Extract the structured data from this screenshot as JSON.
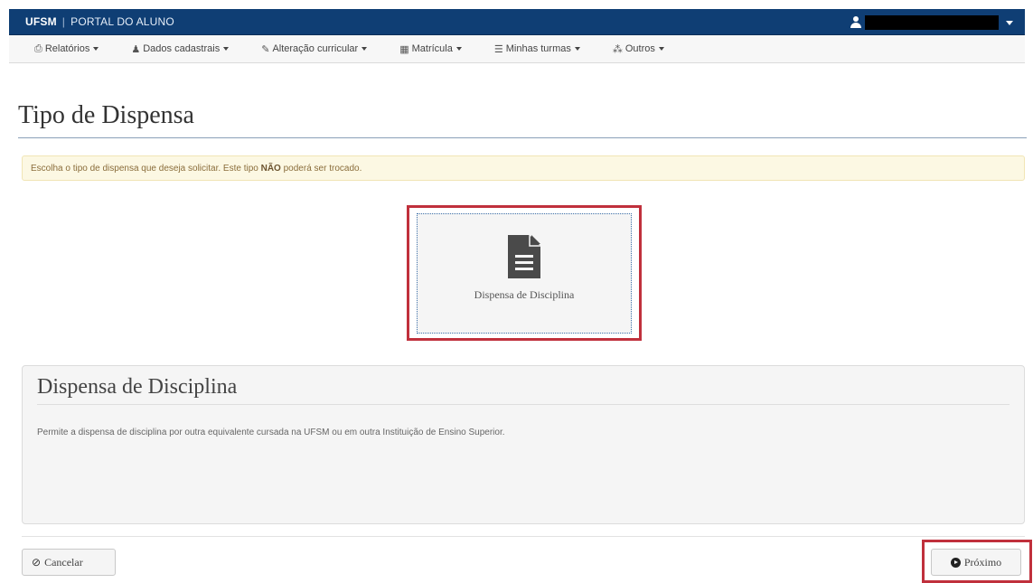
{
  "header": {
    "brand": "UFSM",
    "separator": "|",
    "portal": "PORTAL DO ALUNO"
  },
  "menu": [
    {
      "label": "Relatórios",
      "icon": "print-icon",
      "glyph": "⎙"
    },
    {
      "label": "Dados cadastrais",
      "icon": "user-icon",
      "glyph": "♟"
    },
    {
      "label": "Alteração curricular",
      "icon": "edit-icon",
      "glyph": "✎"
    },
    {
      "label": "Matrícula",
      "icon": "calendar-icon",
      "glyph": "▦"
    },
    {
      "label": "Minhas turmas",
      "icon": "list-icon",
      "glyph": "☰"
    },
    {
      "label": "Outros",
      "icon": "sitemap-icon",
      "glyph": "⁂"
    }
  ],
  "page": {
    "title": "Tipo de Dispensa",
    "alert_before": "Escolha o tipo de dispensa que deseja solicitar. Este tipo ",
    "alert_strong": "NÃO",
    "alert_after": " poderá ser trocado."
  },
  "option": {
    "label": "Dispensa de Disciplina",
    "icon": "document-icon"
  },
  "panel": {
    "title": "Dispensa de Disciplina",
    "description": "Permite a dispensa de disciplina por outra equivalente cursada na UFSM ou em outra Instituição de Ensino Superior."
  },
  "buttons": {
    "cancel": "Cancelar",
    "next": "Próximo"
  },
  "colors": {
    "navbar": "#0f3e74",
    "highlight": "#c0303c",
    "alert_bg": "#fcf8e3"
  }
}
